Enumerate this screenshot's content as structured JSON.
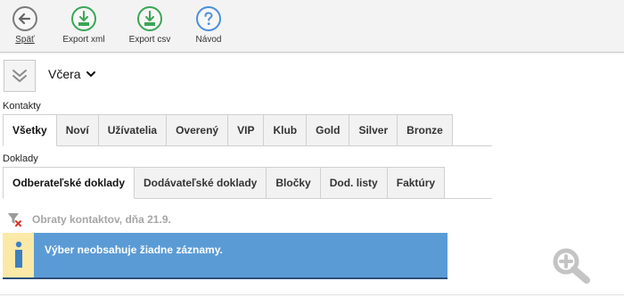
{
  "toolbar": {
    "back_label": "Späť",
    "export_xml_label": "Export xml",
    "export_csv_label": "Export csv",
    "help_label": "Návod"
  },
  "date_filter": {
    "selected": "Včera"
  },
  "contacts": {
    "label": "Kontakty",
    "tabs": [
      "Všetky",
      "Noví",
      "Užívatelia",
      "Overený",
      "VIP",
      "Klub",
      "Gold",
      "Silver",
      "Bronze"
    ]
  },
  "documents": {
    "label": "Doklady",
    "tabs": [
      "Odberateľské doklady",
      "Dodávateľské doklady",
      "Bločky",
      "Dod. listy",
      "Faktúry"
    ]
  },
  "result": {
    "title": "Obraty kontaktov, dňa 21.9.",
    "message": "Výber neobsahuje žiadne záznamy."
  },
  "icons": {
    "back": "arrow-left-icon",
    "export_xml": "download-xml-icon",
    "export_csv": "download-csv-icon",
    "help": "help-icon",
    "collapse": "double-chevron-down-icon",
    "filter_clear": "filter-clear-icon",
    "info": "info-icon",
    "zoom": "zoom-in-icon"
  },
  "colors": {
    "info_background": "#5b9bd5",
    "info_icon_background": "#fbe9a8",
    "export_green": "#3aa655",
    "help_blue": "#4a90d9"
  }
}
